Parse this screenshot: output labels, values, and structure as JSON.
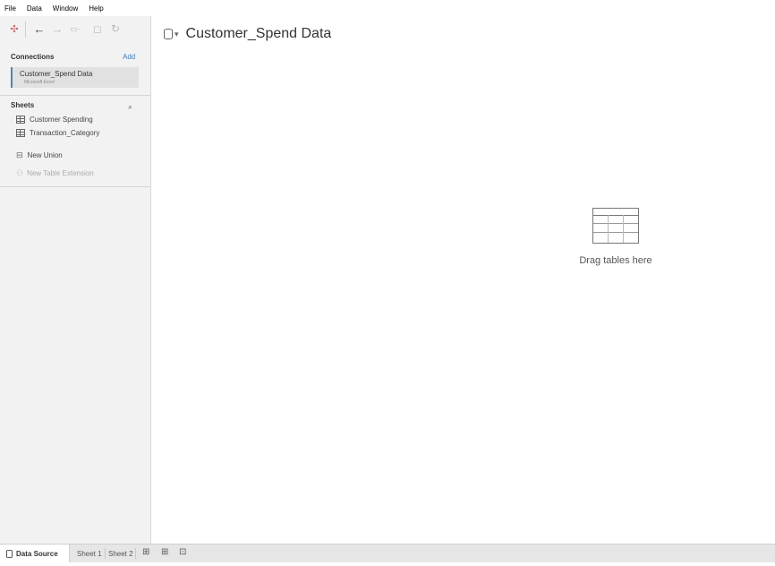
{
  "menu": [
    "File",
    "Data",
    "Window",
    "Help"
  ],
  "left": {
    "connections_label": "Connections",
    "add_label": "Add",
    "connection": {
      "name": "Customer_Spend Data",
      "type": "Microsoft Excel"
    },
    "sheets_label": "Sheets",
    "sheets": [
      "Customer Spending",
      "Transaction_Category"
    ],
    "new_union": "New Union",
    "new_table_extension": "New Table Extension"
  },
  "main": {
    "datasource_title": "Customer_Spend Data",
    "drop_text": "Drag tables here"
  },
  "tabs": {
    "datasource": "Data Source",
    "sheet1": "Sheet 1",
    "sheet2": "Sheet 2"
  },
  "colors": {
    "accent": "#4b84b8",
    "link": "#3a7fc2",
    "pane": "#f2f2f2"
  },
  "icons": [
    "tableau-logo-icon",
    "back-icon",
    "forward-icon",
    "add-datasource-icon",
    "pause-icon",
    "refresh-icon",
    "search-icon",
    "table-icon",
    "union-icon",
    "extension-icon",
    "database-icon",
    "new-worksheet-icon",
    "new-dashboard-icon",
    "new-story-icon"
  ]
}
